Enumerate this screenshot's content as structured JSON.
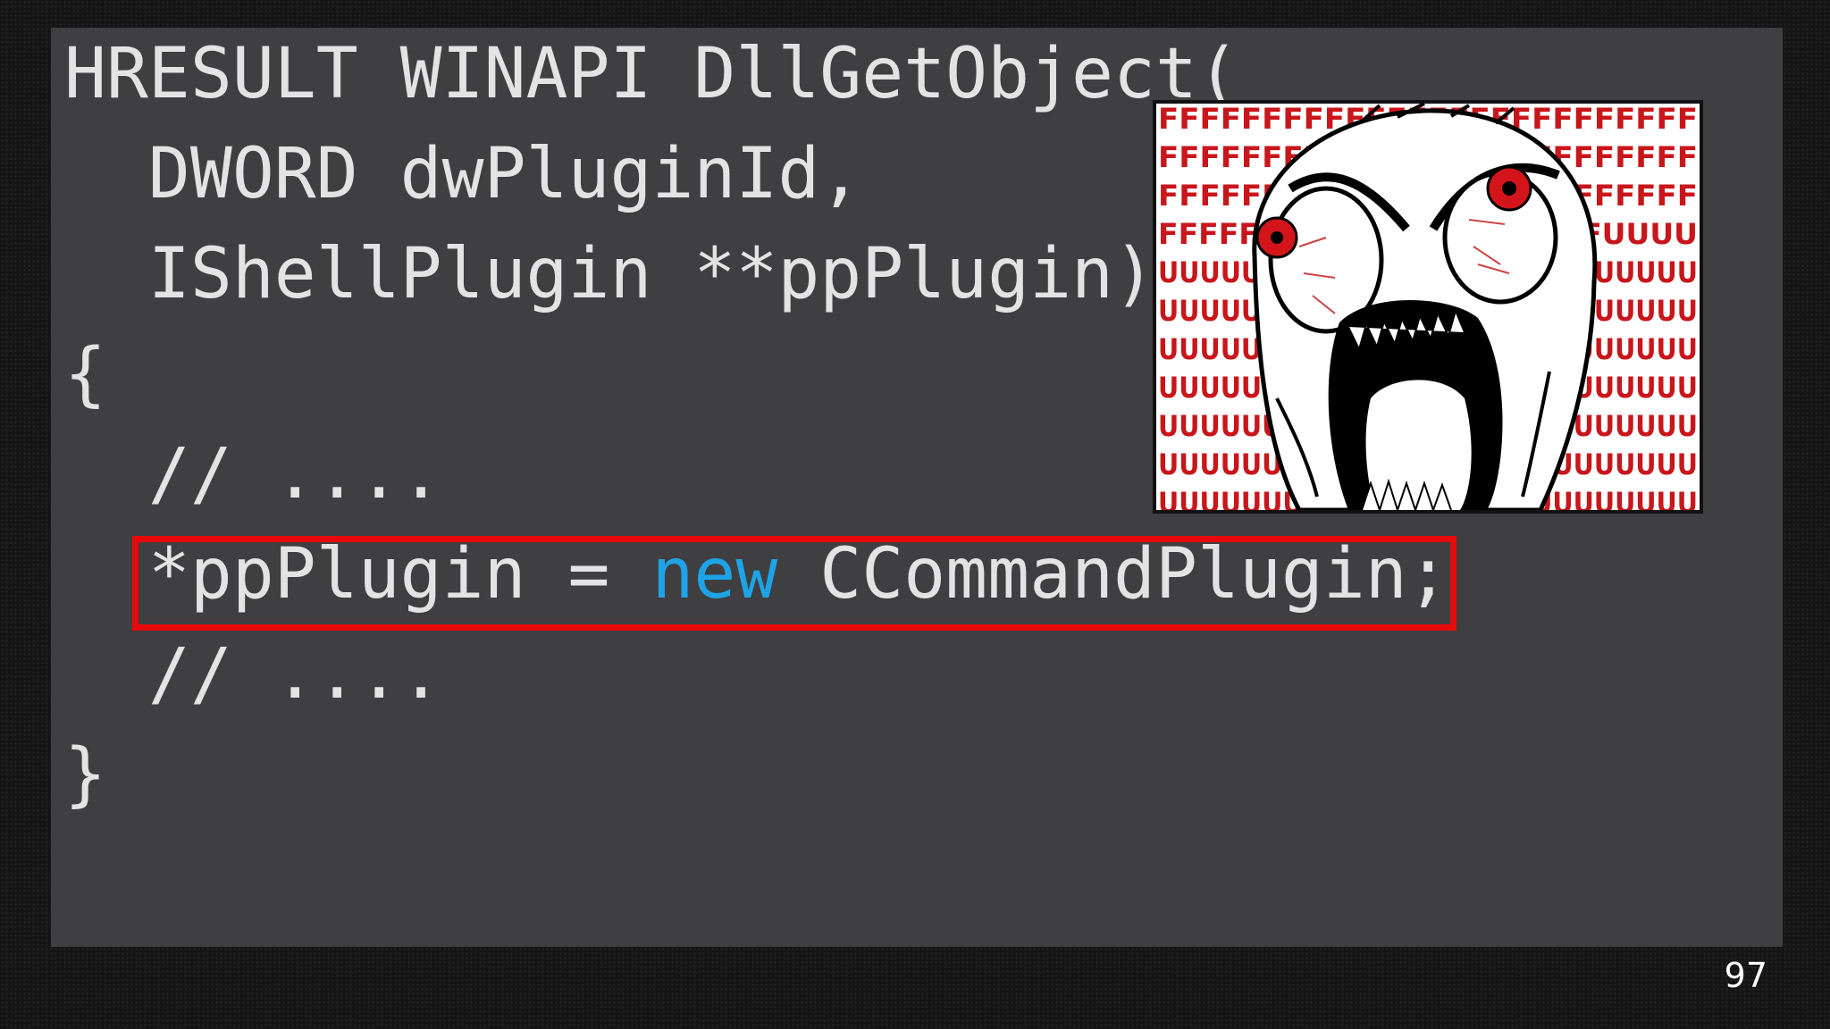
{
  "code": {
    "line1": "HRESULT WINAPI DllGetObject(",
    "line2": "  DWORD dwPluginId,",
    "line3": "  IShellPlugin **ppPlugin)",
    "line4": "{",
    "line5": "  // ....",
    "line6_pre": "  *ppPlugin = ",
    "line6_keyword": "new",
    "line6_post": " CCommandPlugin;",
    "line7": "  // ....",
    "line8": "}"
  },
  "meme": {
    "icon": "rage-face-image",
    "text_rows": [
      "FFFFFFFFFFFFFFFFFFFFFFFFFF",
      "FFFFFFFFFFFFFFFFFFFFFFFFFF",
      "FFFFFFFFFFFFFFFFFFFFFFFFFF",
      "FFFFFFFFFFFFFFFFFFFFFFUUUU",
      "UUUUUUUUUUUUUUUUUUUUUUUUUU",
      "UUUUUUUUUUUUUUUUUUUUUUUUUU",
      "UUUUUUUUUUUUUUUUUUUUUUUUUU",
      "UUUUUUUUUUUUUUUUUUUUUUUUUU",
      "UUUUUUUUUUUUUUUUUUUUUUUUUU",
      "UUUUUUUUUUUUUUUUUUUUUUUUUU",
      "UUUUUUUUUUUUUUUUUUUUUUUUUU"
    ],
    "text_color": "#c8161b"
  },
  "colors": {
    "panel_background": "#3f3e40",
    "code_text": "#e3e3e3",
    "keyword": "#1ea3e6",
    "highlight_border": "#e60a0a"
  },
  "page_number": "97"
}
